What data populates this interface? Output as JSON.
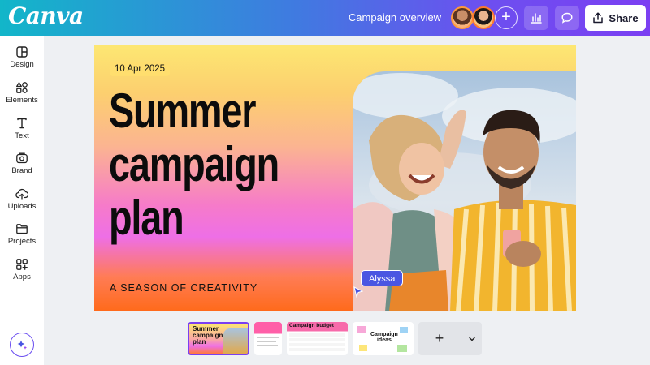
{
  "app": {
    "logo_text": "Canva",
    "document_title": "Campaign overview",
    "share_label": "Share",
    "add_collaborator_label": "+",
    "brand_color": "#7b3ff2"
  },
  "sidebar": {
    "items": [
      {
        "label": "Design",
        "icon": "design-icon"
      },
      {
        "label": "Elements",
        "icon": "elements-icon"
      },
      {
        "label": "Text",
        "icon": "text-icon"
      },
      {
        "label": "Brand",
        "icon": "brand-icon"
      },
      {
        "label": "Uploads",
        "icon": "upload-icon"
      },
      {
        "label": "Projects",
        "icon": "folder-icon"
      },
      {
        "label": "Apps",
        "icon": "apps-icon"
      }
    ],
    "magic_icon": "sparkle-icon"
  },
  "slide": {
    "date": "10 Apr 2025",
    "headline_lines": [
      "Summer",
      "campaign",
      "plan"
    ],
    "tagline": "A SEASON OF CREATIVITY",
    "collaborator_cursor_label": "Alyssa",
    "cursor_color": "#4a56e2"
  },
  "pages": {
    "thumb1_title": [
      "Summer",
      "campaign",
      "plan"
    ],
    "thumb3_title": "Campaign budget",
    "thumb4_title": [
      "Campaign",
      "ideas"
    ],
    "add_page_label": "+"
  }
}
